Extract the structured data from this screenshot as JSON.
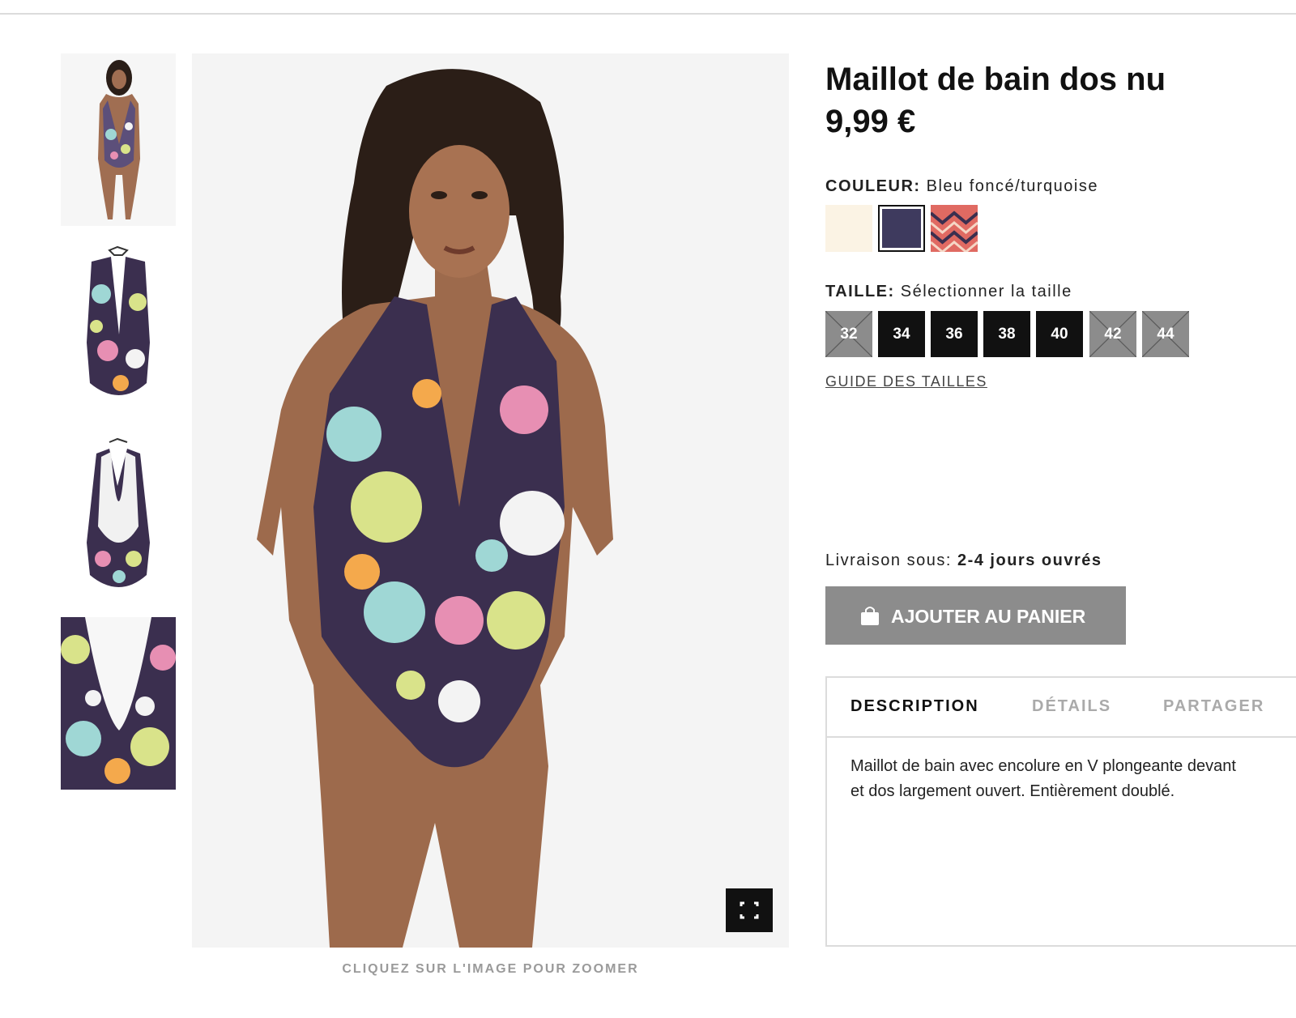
{
  "product": {
    "title": "Maillot de bain dos nu",
    "price": "9,99 €"
  },
  "gallery": {
    "thumbnails": [
      {
        "alt": "model-full-body"
      },
      {
        "alt": "swimsuit-front"
      },
      {
        "alt": "swimsuit-back"
      },
      {
        "alt": "swimsuit-detail"
      }
    ],
    "zoom_hint": "CLIQUEZ SUR L'IMAGE POUR ZOOMER"
  },
  "color": {
    "label": "COULEUR:",
    "value": "Bleu foncé/turquoise",
    "swatches": [
      {
        "name": "cream",
        "color": "#fbf3e4"
      },
      {
        "name": "dark-blue-turquoise",
        "color": "#3e3a5e",
        "selected": true
      },
      {
        "name": "coral-zigzag",
        "color": "#e06a62"
      }
    ]
  },
  "size": {
    "label": "TAILLE:",
    "value": "Sélectionner la taille",
    "options": [
      {
        "label": "32",
        "available": false
      },
      {
        "label": "34",
        "available": true
      },
      {
        "label": "36",
        "available": true
      },
      {
        "label": "38",
        "available": true
      },
      {
        "label": "40",
        "available": true
      },
      {
        "label": "42",
        "available": false
      },
      {
        "label": "44",
        "available": false
      }
    ],
    "guide_label": "GUIDE DES TAILLES"
  },
  "delivery": {
    "label": "Livraison sous:",
    "value": "2-4 jours ouvrés"
  },
  "cart": {
    "button_label": "AJOUTER AU PANIER",
    "icon": "shopping-bag-icon"
  },
  "tabs": {
    "items": [
      {
        "label": "DESCRIPTION",
        "active": true
      },
      {
        "label": "DÉTAILS",
        "active": false
      },
      {
        "label": "PARTAGER",
        "active": false
      }
    ],
    "description_lines": [
      "Maillot de bain avec encolure en V plongeante devant",
      "et dos largement ouvert. Entièrement doublé."
    ]
  },
  "icons": {
    "fullscreen": "fullscreen-icon"
  }
}
